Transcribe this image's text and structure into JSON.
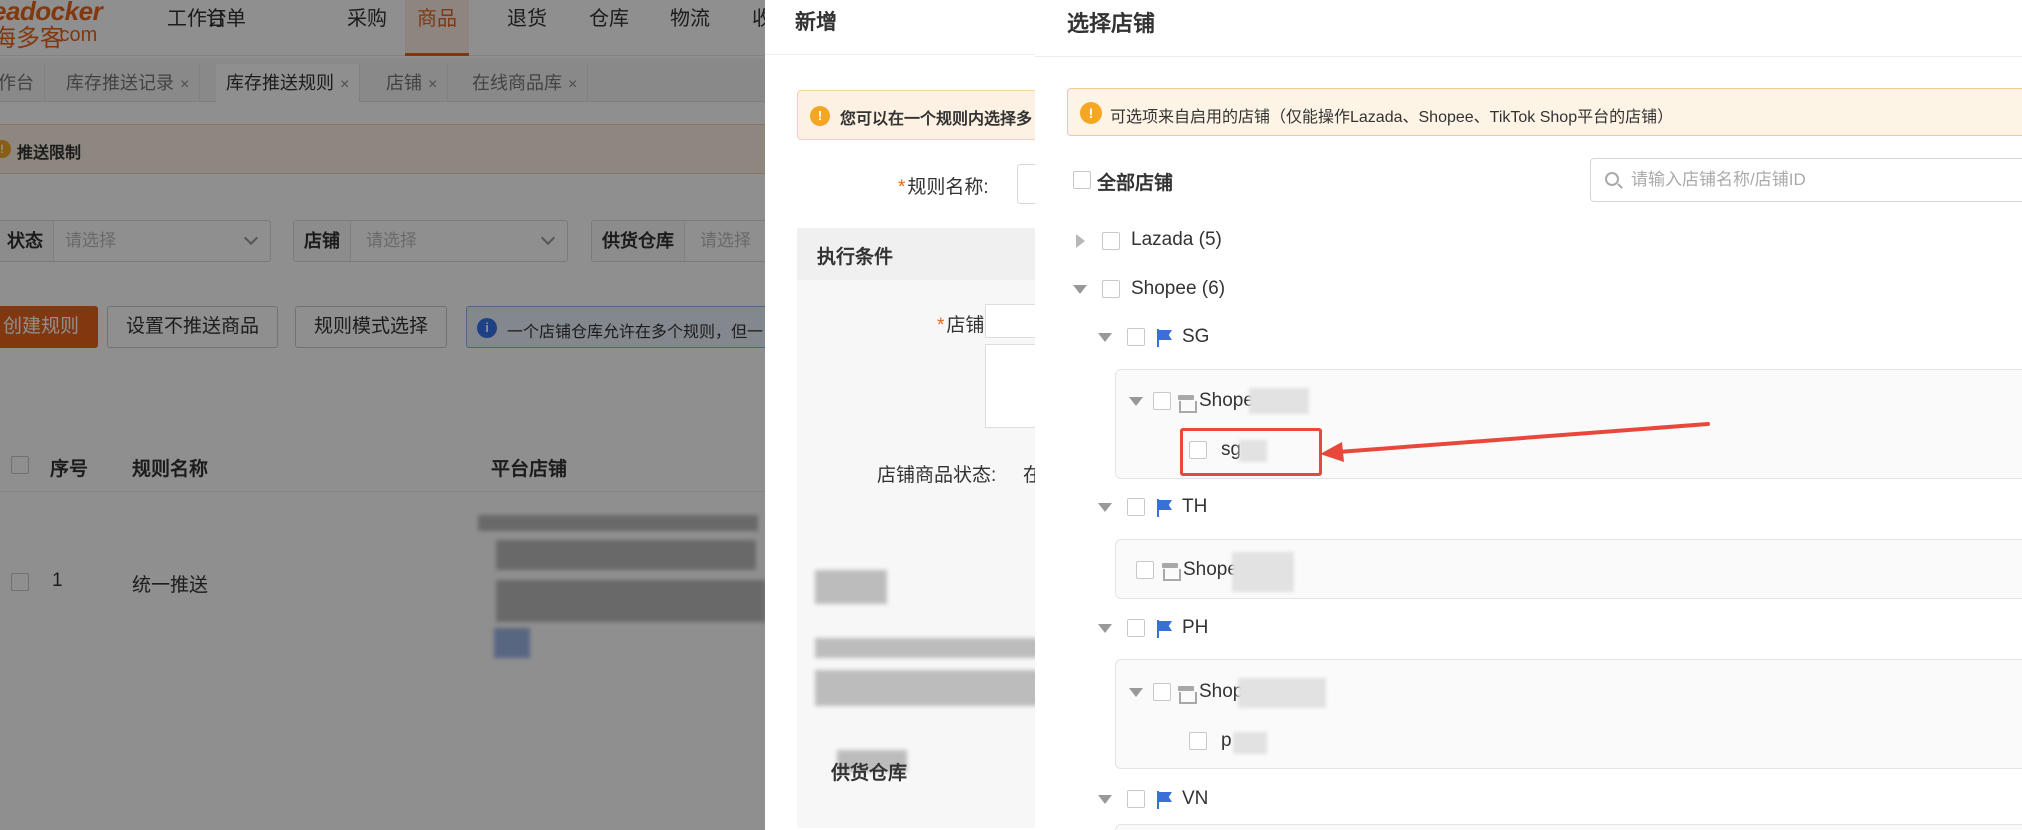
{
  "topnav": {
    "logo_brand": "eadocker",
    "logo_cn": "海多客",
    "logo_com": ".com",
    "items": [
      "工作台",
      "订单",
      "采购",
      "商品",
      "退货",
      "仓库",
      "物流",
      "收"
    ],
    "active_index": 3
  },
  "tabs": [
    {
      "label": "作台",
      "closable": false
    },
    {
      "label": "库存推送记录",
      "closable": true
    },
    {
      "label": "库存推送规则",
      "closable": true,
      "active": true
    },
    {
      "label": "店铺",
      "closable": true
    },
    {
      "label": "在线商品库",
      "closable": true
    }
  ],
  "close_glyph": "×",
  "warn_bar": {
    "text": "推送限制",
    "icon": "!"
  },
  "filters": [
    {
      "label": "状态",
      "placeholder": "请选择"
    },
    {
      "label": "店铺",
      "placeholder": "请选择"
    },
    {
      "label": "供货仓库",
      "placeholder": "请选择"
    }
  ],
  "toolbar": {
    "create_label": "创建规则",
    "no_push_label": "设置不推送商品",
    "mode_label": "规则模式选择",
    "info_text": "一个店铺仓库允许在多个规则，但一",
    "info_icon": "i"
  },
  "table": {
    "headers": [
      "序号",
      "规则名称",
      "平台店铺"
    ],
    "rows": [
      {
        "index": "1",
        "name": "统一推送"
      }
    ]
  },
  "dialog_new": {
    "title": "新增",
    "warn_text": "您可以在一个规则内选择多",
    "warn_icon": "!",
    "rule_name_label": "规则名称:",
    "section_title": "执行条件",
    "shop_label": "店铺:",
    "shop_status_label": "店铺商品状态:",
    "shop_status_value": "在",
    "supply_wh_label": "供货仓库",
    "required_mark": "*"
  },
  "drawer": {
    "title": "选择店铺",
    "alert_icon": "!",
    "alert_text": "可选项来自启用的店铺（仅能操作Lazada、Shopee、TikTok Shop平台的店铺）",
    "all_shops_label": "全部店铺",
    "search_placeholder": "请输入店铺名称/店铺ID",
    "tree": {
      "lazada": {
        "label": "Lazada",
        "count": "(5)"
      },
      "shopee": {
        "label": "Shopee",
        "count": "(6)"
      },
      "regions": {
        "sg": {
          "code": "SG",
          "account": "Shope",
          "store": "sg"
        },
        "th": {
          "code": "TH",
          "account": "Shope"
        },
        "ph": {
          "code": "PH",
          "account": "Shop",
          "store": "p"
        },
        "vn": {
          "code": "VN"
        }
      }
    }
  },
  "colors": {
    "accent": "#e8641c",
    "highlight_red": "#e8473c",
    "flag_blue": "#3a6fd8",
    "alert_bg": "#fef4e6",
    "info_blue": "#3575e8"
  }
}
